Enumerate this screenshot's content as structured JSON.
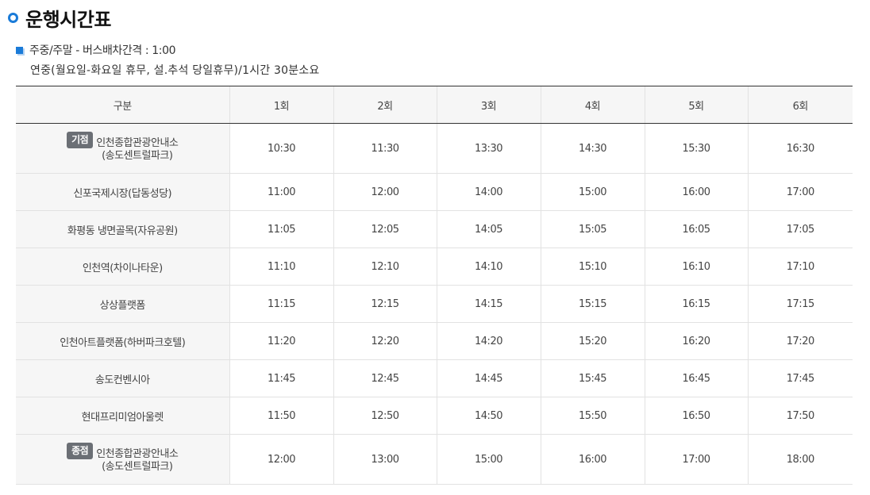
{
  "page": {
    "title": "운행시간표",
    "info_line1": "주중/주말 - 버스배차간격 : 1:00",
    "info_line2": "연중(월요일-화요일 휴무, 설.추석 당일휴무)/1시간 30분소요"
  },
  "table": {
    "headers": [
      "구분",
      "1회",
      "2회",
      "3회",
      "4회",
      "5회",
      "6회"
    ],
    "rows": [
      {
        "badge": "기점",
        "stop_line1": "인천종합관광안내소",
        "stop_line2": "(송도센트럴파크)",
        "times": [
          "10:30",
          "11:30",
          "13:30",
          "14:30",
          "15:30",
          "16:30"
        ]
      },
      {
        "stop": "신포국제시장(답동성당)",
        "times": [
          "11:00",
          "12:00",
          "14:00",
          "15:00",
          "16:00",
          "17:00"
        ]
      },
      {
        "stop": "화평동 냉면골목(자유공원)",
        "times": [
          "11:05",
          "12:05",
          "14:05",
          "15:05",
          "16:05",
          "17:05"
        ]
      },
      {
        "stop": "인천역(차이나타운)",
        "times": [
          "11:10",
          "12:10",
          "14:10",
          "15:10",
          "16:10",
          "17:10"
        ]
      },
      {
        "stop": "상상플랫폼",
        "times": [
          "11:15",
          "12:15",
          "14:15",
          "15:15",
          "16:15",
          "17:15"
        ]
      },
      {
        "stop": "인천아트플랫폼(하버파크호텔)",
        "times": [
          "11:20",
          "12:20",
          "14:20",
          "15:20",
          "16:20",
          "17:20"
        ]
      },
      {
        "stop": "송도컨벤시아",
        "times": [
          "11:45",
          "12:45",
          "14:45",
          "15:45",
          "16:45",
          "17:45"
        ]
      },
      {
        "stop": "현대프리미엄아울렛",
        "times": [
          "11:50",
          "12:50",
          "14:50",
          "15:50",
          "16:50",
          "17:50"
        ]
      },
      {
        "badge": "종점",
        "stop_line1": "인천종합관광안내소",
        "stop_line2": "(송도센트럴파크)",
        "times": [
          "12:00",
          "13:00",
          "15:00",
          "16:00",
          "17:00",
          "18:00"
        ]
      }
    ]
  },
  "colors": {
    "accent": "#1a7bd8",
    "badge": "#6b6f75",
    "header_bg": "#f6f6f6"
  },
  "icons": {
    "title": "circle-ring-icon",
    "info": "square-bullet-icon"
  }
}
